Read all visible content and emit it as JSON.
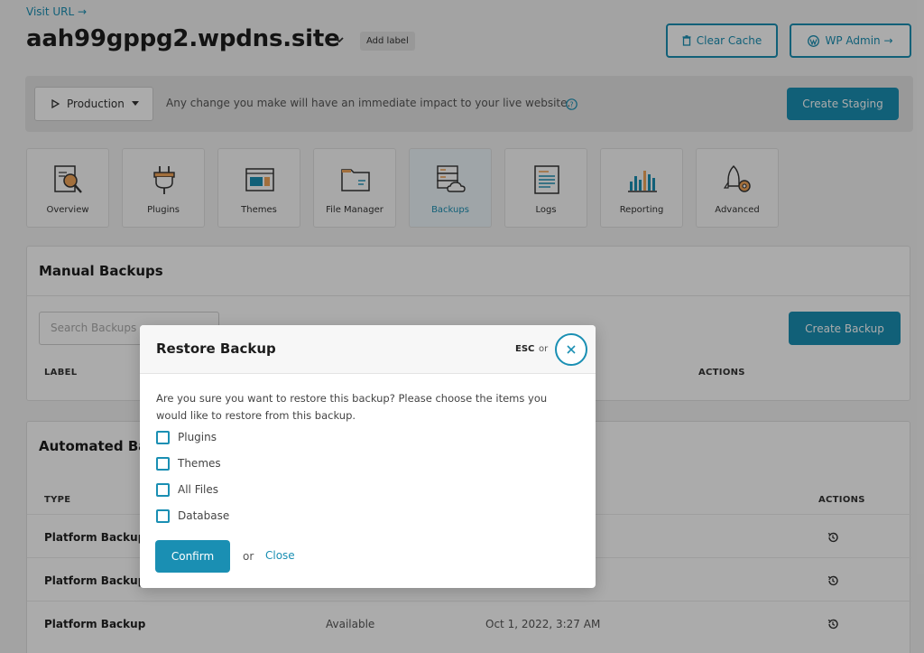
{
  "header": {
    "visit_url": "Visit URL →",
    "site_name": "aah99gppg2.wpdns.site",
    "add_label": "Add label",
    "clear_cache": "Clear Cache",
    "wp_admin": "WP Admin →"
  },
  "environment": {
    "selected": "Production",
    "notice": "Any change you make will have an immediate impact to your live website.",
    "create_staging": "Create Staging"
  },
  "tools": [
    {
      "label": "Overview",
      "icon": "overview-icon"
    },
    {
      "label": "Plugins",
      "icon": "plug-icon"
    },
    {
      "label": "Themes",
      "icon": "themes-icon"
    },
    {
      "label": "File Manager",
      "icon": "folder-icon"
    },
    {
      "label": "Backups",
      "icon": "backup-server-icon",
      "active": true
    },
    {
      "label": "Logs",
      "icon": "logs-icon"
    },
    {
      "label": "Reporting",
      "icon": "bar-chart-icon"
    },
    {
      "label": "Advanced",
      "icon": "rocket-gear-icon"
    }
  ],
  "manual_backups": {
    "title": "Manual Backups",
    "search_placeholder": "Search Backups",
    "create_button": "Create Backup",
    "columns": {
      "label": "LABEL",
      "actions": "ACTIONS"
    }
  },
  "automated_backups": {
    "title": "Automated Ba",
    "columns": {
      "type": "TYPE",
      "actions": "ACTIONS"
    },
    "rows": [
      {
        "type": "Platform Backup",
        "status": "",
        "date": ""
      },
      {
        "type": "Platform Backup",
        "status": "",
        "date": ""
      },
      {
        "type": "Platform Backup",
        "status": "Available",
        "date": "Oct 1, 2022, 3:27 AM"
      }
    ]
  },
  "modal": {
    "title": "Restore Backup",
    "esc": "ESC",
    "or": "or",
    "message": "Are you sure you want to restore this backup? Please choose the items you would like to restore from this backup.",
    "options": [
      "Plugins",
      "Themes",
      "All Files",
      "Database"
    ],
    "confirm": "Confirm",
    "or_text": "or",
    "close": "Close"
  },
  "colors": {
    "accent": "#1a8fb3",
    "background": "#f4f4f4"
  }
}
